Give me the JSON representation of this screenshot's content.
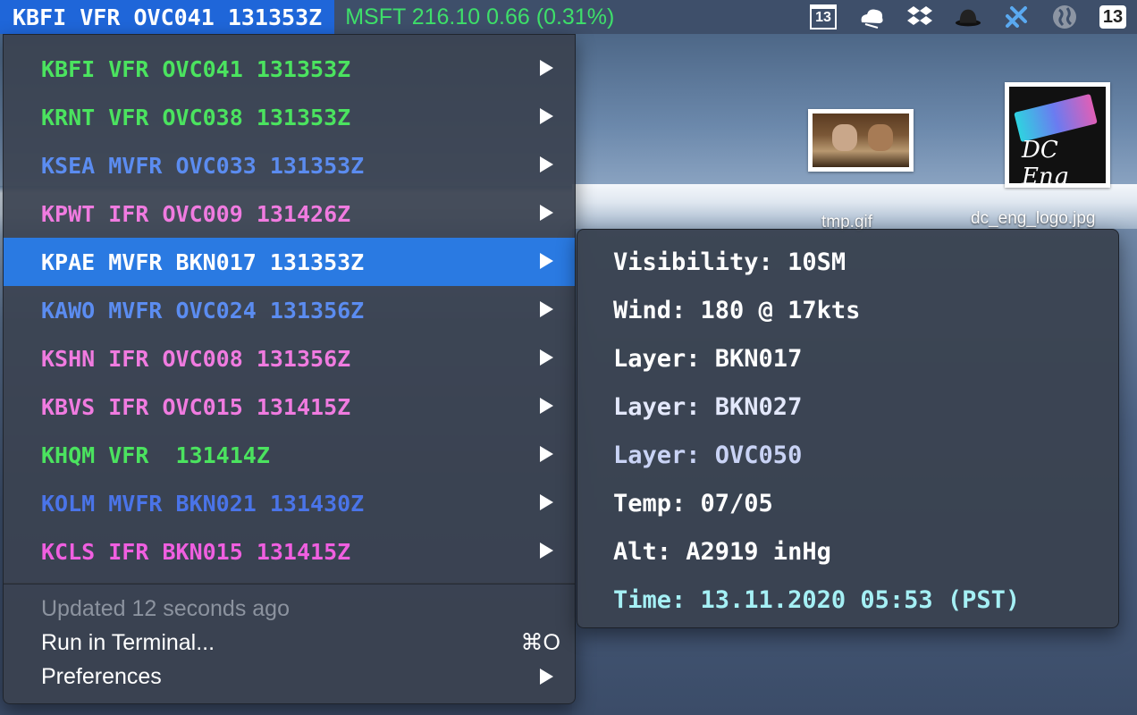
{
  "menubar": {
    "title": "KBFI VFR OVC041 131353Z",
    "stock": "MSFT 216.10 0.66 (0.31%)",
    "calendar_day": "13",
    "badge_count": "13",
    "stock_color": "#3ee06a",
    "accent_color": "#1f66d9"
  },
  "desktop": {
    "files": [
      {
        "label": "tmp.gif"
      },
      {
        "label": "dc_eng_logo.jpg"
      }
    ]
  },
  "menu": {
    "stations": [
      {
        "text": "KBFI VFR OVC041 131353Z",
        "category": "VFR",
        "color": "#4be35f"
      },
      {
        "text": "KRNT VFR OVC038 131353Z",
        "category": "VFR",
        "color": "#4be35f"
      },
      {
        "text": "KSEA MVFR OVC033 131353Z",
        "category": "MVFR",
        "color": "#5b8cf0"
      },
      {
        "text": "KPWT IFR OVC009 131426Z",
        "category": "IFR",
        "color": "#f07be0"
      },
      {
        "text": "KPAE MVFR BKN017 131353Z",
        "category": "MVFR",
        "color": "#ffffff",
        "selected": true
      },
      {
        "text": "KAWO MVFR OVC024 131356Z",
        "category": "MVFR",
        "color": "#5b8cf0"
      },
      {
        "text": "KSHN IFR OVC008 131356Z",
        "category": "IFR",
        "color": "#f07be0"
      },
      {
        "text": "KBVS IFR OVC015 131415Z",
        "category": "IFR",
        "color": "#f07be0"
      },
      {
        "text": "KHQM VFR  131414Z",
        "category": "VFR",
        "color": "#4be35f"
      },
      {
        "text": "KOLM MVFR BKN021 131430Z",
        "category": "MVFR",
        "color": "#4a74e8"
      },
      {
        "text": "KCLS IFR BKN015 131415Z",
        "category": "IFR",
        "color": "#f05fe0"
      }
    ],
    "updated": "Updated 12 seconds ago",
    "run_in_terminal": "Run in Terminal...",
    "run_shortcut": "⌘O",
    "preferences": "Preferences"
  },
  "submenu": {
    "details": [
      {
        "text": "Visibility: 10SM",
        "color": "#ffffff"
      },
      {
        "text": "Wind: 180 @ 17kts",
        "color": "#ffffff"
      },
      {
        "text": "Layer: BKN017",
        "color": "#ffffff"
      },
      {
        "text": "Layer: BKN027",
        "color": "#e3e8fb"
      },
      {
        "text": "Layer: OVC050",
        "color": "#c9d3f5"
      },
      {
        "text": "Temp: 07/05",
        "color": "#ffffff"
      },
      {
        "text": "Alt: A2919 inHg",
        "color": "#ffffff"
      },
      {
        "text": "Time: 13.11.2020 05:53 (PST)",
        "color": "#a5f0f5"
      }
    ]
  }
}
